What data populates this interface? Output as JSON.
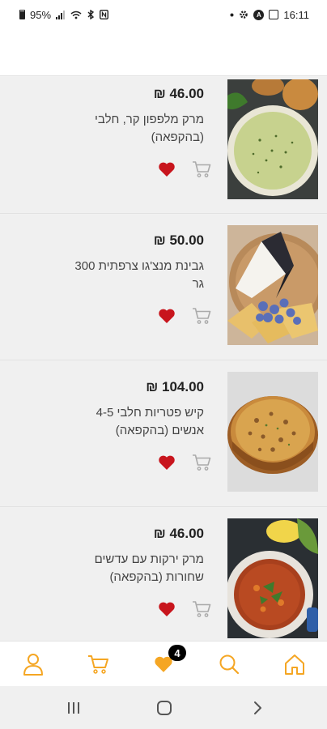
{
  "status_bar": {
    "battery_text": "95%",
    "time": "16:11"
  },
  "products": [
    {
      "price": "46.00 ₪",
      "name": "מרק מלפפון קר, חלבי (בהקפאה)",
      "image": "cold-cucumber-soup"
    },
    {
      "price": "50.00 ₪",
      "name": "גבינת מנצ'גו צרפתית 300 גר",
      "image": "manchego-cheese"
    },
    {
      "price": "104.00 ₪",
      "name": "קיש פטריות חלבי 4-5 אנשים (בהקפאה)",
      "image": "mushroom-quiche"
    },
    {
      "price": "46.00 ₪",
      "name": "מרק ירקות עם עדשים שחורות (בהקפאה)",
      "image": "lentil-vegetable-soup"
    }
  ],
  "bottom_nav": {
    "favorites_badge": "4",
    "items": [
      "user-icon",
      "cart-icon",
      "heart-icon",
      "search-icon",
      "home-icon"
    ]
  },
  "colors": {
    "accent": "#f5a623",
    "heart": "#c8151d",
    "cart_outline": "#aaaaaa",
    "card_bg": "#f0f0f0"
  }
}
